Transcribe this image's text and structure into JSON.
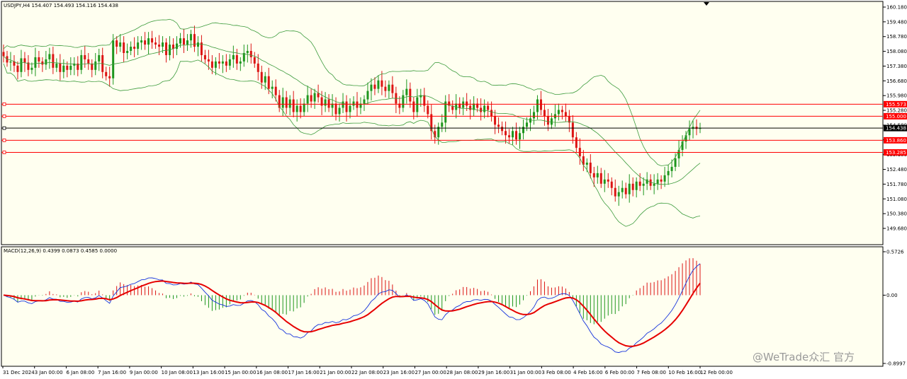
{
  "chart_data": [
    {
      "type": "candlestick",
      "title": "USDJPY,H4  154.407 154.493 154.116 154.438",
      "symbol": "USDJPY",
      "timeframe": "H4",
      "ohlc_current": {
        "open": 154.407,
        "high": 154.493,
        "low": 154.116,
        "close": 154.438
      },
      "y_ticks": [
        "160.180",
        "159.480",
        "158.780",
        "158.080",
        "157.380",
        "156.680",
        "155.980",
        "155.280",
        "154.580",
        "153.880",
        "153.180",
        "152.480",
        "151.780",
        "151.080",
        "150.380",
        "149.680"
      ],
      "ylim": [
        149.68,
        160.18
      ],
      "x_ticks": [
        "31 Dec 2024",
        "3 Jan 00:00",
        "6 Jan 08:00",
        "7 Jan 16:00",
        "9 Jan 00:00",
        "10 Jan 08:00",
        "13 Jan 16:00",
        "15 Jan 00:00",
        "16 Jan 08:00",
        "17 Jan 16:00",
        "21 Jan 00:00",
        "22 Jan 08:00",
        "23 Jan 16:00",
        "27 Jan 00:00",
        "28 Jan 08:00",
        "29 Jan 16:00",
        "31 Jan 00:00",
        "3 Feb 08:00",
        "4 Feb 16:00",
        "6 Feb 00:00",
        "7 Feb 08:00",
        "10 Feb 16:00",
        "12 Feb 00:00"
      ],
      "levels": [
        {
          "label": "155.573",
          "value": 155.573,
          "color": "#ff0000"
        },
        {
          "label": "155.000",
          "value": 155.0,
          "color": "#ff0000"
        },
        {
          "label": "154.438",
          "value": 154.438,
          "color": "#000000"
        },
        {
          "label": "153.860",
          "value": 153.86,
          "color": "#ff0000"
        },
        {
          "label": "153.285",
          "value": 153.285,
          "color": "#ff0000"
        }
      ],
      "closes": [
        157.85,
        157.55,
        157.6,
        157.4,
        157.1,
        157.75,
        157.55,
        157.2,
        157.3,
        157.8,
        157.6,
        157.45,
        157.7,
        157.95,
        157.3,
        157.5,
        157.1,
        157.4,
        157.2,
        157.4,
        157.5,
        157.2,
        157.9,
        157.7,
        157.5,
        157.2,
        157.6,
        157.9,
        157.1,
        156.9,
        156.8,
        158.6,
        158.3,
        158.5,
        158.0,
        158.1,
        158.3,
        158.2,
        158.5,
        158.6,
        158.4,
        158.7,
        158.5,
        158.4,
        158.3,
        158.5,
        157.9,
        158.4,
        158.2,
        158.45,
        158.7,
        158.4,
        158.6,
        158.9,
        158.3,
        158.5,
        157.9,
        157.7,
        157.6,
        157.3,
        157.6,
        157.5,
        157.6,
        157.4,
        157.7,
        157.9,
        157.5,
        157.6,
        158.0,
        158.1,
        157.8,
        157.5,
        157.1,
        156.6,
        156.9,
        156.3,
        156.4,
        156.0,
        155.4,
        155.9,
        155.4,
        155.8,
        155.2,
        155.5,
        155.2,
        155.6,
        156.0,
        155.7,
        156.1,
        155.9,
        155.5,
        155.8,
        155.4,
        155.6,
        155.1,
        155.4,
        155.7,
        155.2,
        155.5,
        155.7,
        155.4,
        155.6,
        155.8,
        156.2,
        156.5,
        156.3,
        156.7,
        156.4,
        156.2,
        156.5,
        156.1,
        155.6,
        155.4,
        156.0,
        156.3,
        155.7,
        155.2,
        155.9,
        156.0,
        155.5,
        155.1,
        154.3,
        154.0,
        154.5,
        154.7,
        155.7,
        155.5,
        155.3,
        155.6,
        155.4,
        155.7,
        155.5,
        155.3,
        155.6,
        155.4,
        155.2,
        155.5,
        155.3,
        155.0,
        154.6,
        154.5,
        154.3,
        154.1,
        154.0,
        154.3,
        153.9,
        154.2,
        154.5,
        154.7,
        154.9,
        155.2,
        155.8,
        155.3,
        155.0,
        154.6,
        154.9,
        155.1,
        155.3,
        155.2,
        155.0,
        154.7,
        154.0,
        153.5,
        153.1,
        152.7,
        152.8,
        152.3,
        152.1,
        152.3,
        151.8,
        152.0,
        151.9,
        151.6,
        151.2,
        151.4,
        151.6,
        151.3,
        151.8,
        151.5,
        151.9,
        151.7,
        151.8,
        152.0,
        151.7,
        151.8,
        152.0,
        151.9,
        152.2,
        152.4,
        152.6,
        153.0,
        153.4,
        153.8,
        154.1,
        154.4,
        154.5,
        154.4,
        154.44
      ],
      "indicator": "Bollinger Bands"
    },
    {
      "type": "macd",
      "title": "MACD(12,26,9) 0.4399 0.0873 0.4585 0.0000",
      "params": "12,26,9",
      "values_shown": [
        "0.4399",
        "0.0873",
        "0.4585",
        "0.0000"
      ],
      "y_ticks": [
        "0.5726",
        "0.00",
        "-0.8997"
      ],
      "ylim": [
        -0.8997,
        0.5726
      ],
      "colors": {
        "histogram_up": "#dc1414",
        "histogram_down": "#1e961e",
        "macd": "#1432dc",
        "signal": "#e60000"
      }
    }
  ],
  "watermark": "@WeTrade众汇 官方"
}
